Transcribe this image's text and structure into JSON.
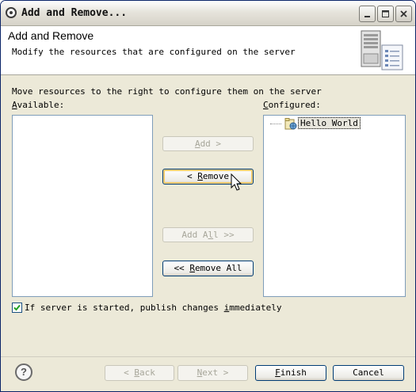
{
  "window": {
    "title": "Add and Remove..."
  },
  "header": {
    "title": "Add and Remove",
    "description": "Modify the resources that are configured on the server"
  },
  "content": {
    "instructions": "Move resources to the right to configure them on the server",
    "available_label_prefix": "",
    "available_label_mnemonic": "A",
    "available_label_rest": "vailable:",
    "configured_label_prefix": "",
    "configured_label_mnemonic": "C",
    "configured_label_rest": "onfigured:",
    "available_items": [],
    "configured_items": [
      {
        "label": "Hello World",
        "selected": true
      }
    ]
  },
  "buttons": {
    "add": {
      "mn": "A",
      "rest": "dd >",
      "enabled": false
    },
    "remove": {
      "pre": "< ",
      "mn": "R",
      "rest": "emove",
      "enabled": true,
      "focused": true
    },
    "add_all": {
      "pre": "Add A",
      "mn": "l",
      "rest": "l >>",
      "enabled": false
    },
    "remove_all": {
      "pre": "<< ",
      "mn": "R",
      "rest": "emove All",
      "enabled": true
    }
  },
  "publish_checkbox": {
    "checked": true,
    "pre": "If server is started, publish changes ",
    "mn": "i",
    "rest": "mmediately"
  },
  "footer": {
    "back": {
      "pre": "< ",
      "mn": "B",
      "rest": "ack",
      "enabled": false
    },
    "next": {
      "mn": "N",
      "rest": "ext >",
      "enabled": false
    },
    "finish": {
      "mn": "F",
      "rest": "inish",
      "enabled": true
    },
    "cancel": {
      "label": "Cancel",
      "enabled": true
    }
  },
  "icons": {
    "title_icon": "eclipse-icon",
    "header_graphic": "server-wizard-icon",
    "help_icon": "help-icon",
    "project_icon": "web-project-icon"
  },
  "colors": {
    "title_border": "#0a2468",
    "button_border": "#003c74",
    "disabled_text": "#a7a69a",
    "selected_item_bg": "#e8e6dd"
  }
}
